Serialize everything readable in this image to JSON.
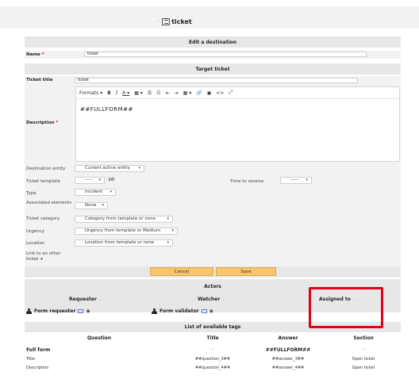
{
  "tab": {
    "prefix": "»",
    "title": "ticket",
    "suffix": "··"
  },
  "edit_destination": {
    "title": "Edit a destination",
    "name_label": "Name",
    "name_required": "*",
    "name_value": "ticket"
  },
  "target_ticket": {
    "title": "Target ticket",
    "ticket_title_label": "Ticket title",
    "ticket_title_value": "ticket",
    "description_label": "Description",
    "description_required": "*",
    "editor_toolbar": [
      "Formats",
      "B",
      "I",
      "A",
      "▦",
      "☰",
      "☷",
      "⇤",
      "⇥",
      "▦",
      "🔗",
      "▣",
      "<>",
      "⤢"
    ],
    "editor_content": "##FULLFORM##"
  },
  "fields": {
    "destination_entity_label": "Destination entity",
    "destination_entity_value": "Current active entity",
    "ticket_template_label": "Ticket template",
    "ticket_template_value": "-----",
    "time_to_resolve_label": "Time to resolve",
    "time_to_resolve_value": "-----",
    "type_label": "Type",
    "type_value": "Incident",
    "associated_label": "Associated elements",
    "associated_value": "None",
    "category_label": "Ticket category",
    "category_value": "Category from template or none",
    "urgency_label": "Urgency",
    "urgency_value": "Urgency from template or Medium",
    "location_label": "Location",
    "location_value": "Location from template or none",
    "link_label": "Link to an other ticket",
    "link_plus": "+"
  },
  "buttons": {
    "cancel": "Cancel",
    "save": "Save"
  },
  "actors": {
    "title": "Actors",
    "requester_head": "Requester",
    "watcher_head": "Watcher",
    "assigned_head": "Assigned to",
    "head_suffix": "⌄",
    "requester_item": "Form requester",
    "watcher_item": "Form validator",
    "eye": "◉"
  },
  "tags": {
    "title": "List of available tags",
    "columns": [
      "Question",
      "Title",
      "Answer",
      "Section"
    ],
    "rows": [
      [
        "Full form",
        "-",
        "##FULLFORM##",
        "-"
      ],
      [
        "Title",
        "##question_3##",
        "##answer_3##",
        "Open ticket"
      ],
      [
        "Description",
        "##question_4##",
        "##answer_4##",
        "Open ticket"
      ]
    ]
  },
  "colors": {
    "highlight": "#e0001b",
    "button": "#f8c56a",
    "header_bg": "#e7e7e7"
  }
}
